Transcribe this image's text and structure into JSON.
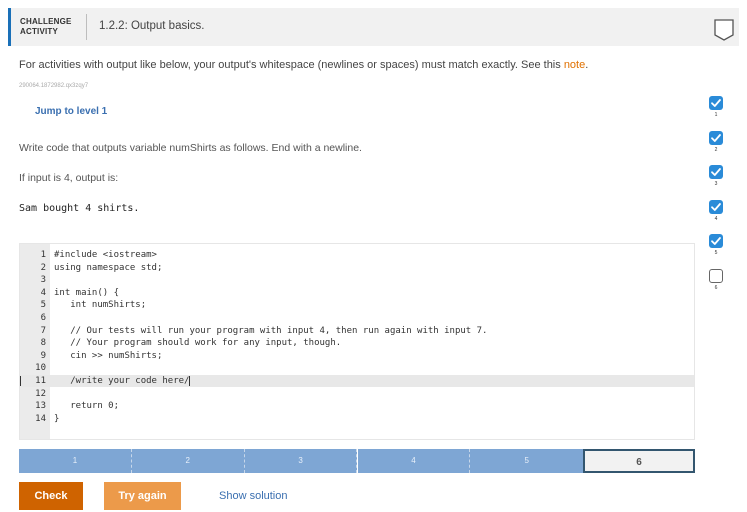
{
  "header": {
    "tag_line1": "CHALLENGE",
    "tag_line2": "ACTIVITY",
    "title": "1.2.2: Output basics."
  },
  "intro": {
    "text": "For activities with output like below, your output's whitespace (newlines or spaces) must match exactly. See this ",
    "link": "note",
    "suffix": "."
  },
  "challenge_id": "290064.1872982.qx3zqy7",
  "jump_label": "Jump to level 1",
  "instructions": "Write code that outputs variable numShirts as follows. End with a newline.",
  "input_note": "If input is 4, output is:",
  "sample_output": "Sam bought 4 shirts.",
  "code_lines": [
    {
      "n": "1",
      "text": "#include <iostream>"
    },
    {
      "n": "2",
      "text": "using namespace std;"
    },
    {
      "n": "3",
      "text": ""
    },
    {
      "n": "4",
      "text": "int main() {"
    },
    {
      "n": "5",
      "text": "   int numShirts;"
    },
    {
      "n": "6",
      "text": ""
    },
    {
      "n": "7",
      "text": "   // Our tests will run your program with input 4, then run again with input 7."
    },
    {
      "n": "8",
      "text": "   // Your program should work for any input, though."
    },
    {
      "n": "9",
      "text": "   cin >> numShirts;"
    },
    {
      "n": "10",
      "text": ""
    },
    {
      "n": "11",
      "text": "   /write your code here/"
    },
    {
      "n": "12",
      "text": ""
    },
    {
      "n": "13",
      "text": "   return 0;"
    },
    {
      "n": "14",
      "text": "}"
    }
  ],
  "levels": [
    "1",
    "2",
    "3",
    "4",
    "5",
    "6"
  ],
  "current_level": "6",
  "buttons": {
    "check": "Check",
    "try_again": "Try again",
    "show_solution": "Show solution"
  },
  "progress": [
    {
      "n": "1",
      "done": true
    },
    {
      "n": "2",
      "done": true
    },
    {
      "n": "3",
      "done": true
    },
    {
      "n": "4",
      "done": true
    },
    {
      "n": "5",
      "done": true
    },
    {
      "n": "6",
      "done": false
    }
  ],
  "colors": {
    "accent": "#1a70b8",
    "link": "#e07000",
    "check_button": "#cf6300",
    "try_again_button": "#ec9a4a",
    "level_bar": "#7ea6d4",
    "checkbox_done": "#2a8bd8"
  }
}
